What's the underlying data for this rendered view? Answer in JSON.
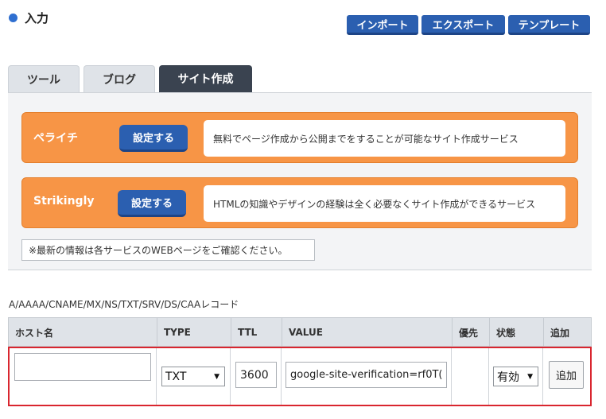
{
  "header": {
    "title": "入力",
    "buttons": {
      "import": "インポート",
      "export": "エクスポート",
      "template": "テンプレート"
    }
  },
  "tabs": [
    {
      "label": "ツール",
      "active": false
    },
    {
      "label": "ブログ",
      "active": false
    },
    {
      "label": "サイト作成",
      "active": true
    }
  ],
  "services": [
    {
      "name": "ペライチ",
      "button": "設定する",
      "description": "無料でページ作成から公開までをすることが可能なサイト作成サービス"
    },
    {
      "name": "Strikingly",
      "button": "設定する",
      "description": "HTMLの知識やデザインの経験は全く必要なくサイト作成ができるサービス"
    }
  ],
  "notice": "※最新の情報は各サービスのWEBページをご確認ください。",
  "records": {
    "caption": "A/AAAA/CNAME/MX/NS/TXT/SRV/DS/CAAレコード",
    "columns": [
      "ホスト名",
      "TYPE",
      "TTL",
      "VALUE",
      "優先",
      "状態",
      "追加"
    ],
    "row": {
      "host": "",
      "type": "TXT",
      "ttl": "3600",
      "value": "google-site-verification=rf0T(",
      "priority": "",
      "status": "有効",
      "add_label": "追加"
    }
  },
  "colors": {
    "accent": "#2b5fb0",
    "service_card": "#f79546",
    "active_tab": "#3a4350",
    "row_highlight": "#d9262f"
  }
}
